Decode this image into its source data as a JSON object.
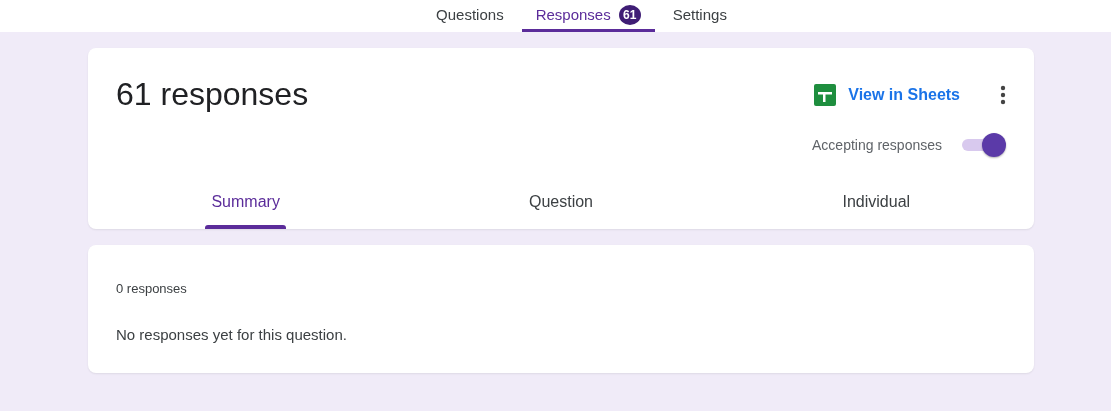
{
  "top_tabs": [
    {
      "label": "Questions",
      "selected": false
    },
    {
      "label": "Responses",
      "selected": true,
      "badge": "61"
    },
    {
      "label": "Settings",
      "selected": false
    }
  ],
  "header": {
    "title": "61 responses",
    "sheets_button": "View in Sheets",
    "accepting": {
      "label": "Accepting responses",
      "on": true
    }
  },
  "view_tabs": [
    {
      "label": "Summary",
      "selected": true
    },
    {
      "label": "Question",
      "selected": false
    },
    {
      "label": "Individual",
      "selected": false
    }
  ],
  "question_card": {
    "count": "0 responses",
    "message": "No responses yet for this question."
  }
}
